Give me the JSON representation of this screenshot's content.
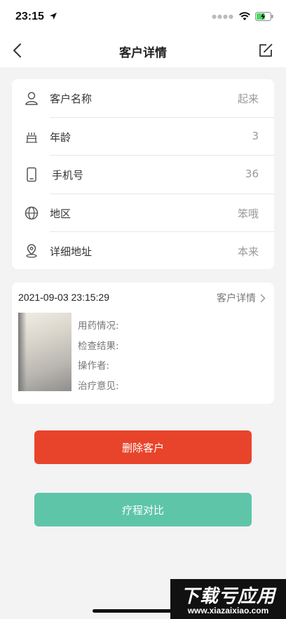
{
  "status_bar": {
    "time": "23:15"
  },
  "nav": {
    "title": "客户详情",
    "back_icon": "chevron-left-icon",
    "edit_icon": "edit-icon"
  },
  "customer_info": {
    "rows": [
      {
        "label": "客户名称",
        "value": "起来",
        "icon": "user-icon"
      },
      {
        "label": "年龄",
        "value": "3",
        "icon": "cake-icon"
      },
      {
        "label": "手机号",
        "value": "36",
        "icon": "phone-icon"
      },
      {
        "label": "地区",
        "value": "笨哦",
        "icon": "globe-icon"
      },
      {
        "label": "详细地址",
        "value": "本来",
        "icon": "location-pin-icon"
      }
    ]
  },
  "record": {
    "datetime": "2021-09-03 23:15:29",
    "detail_link": "客户详情",
    "fields": [
      "用药情况:",
      "检查结果:",
      "操作者:",
      "治疗意见:"
    ]
  },
  "actions": {
    "delete_label": "删除客户",
    "compare_label": "疗程对比"
  },
  "colors": {
    "delete": "#e8442b",
    "compare": "#5ec5a9",
    "background": "#f3f3f3"
  },
  "watermark": {
    "title": "下载亏应用",
    "url": "www.xiazaixiao.com"
  }
}
